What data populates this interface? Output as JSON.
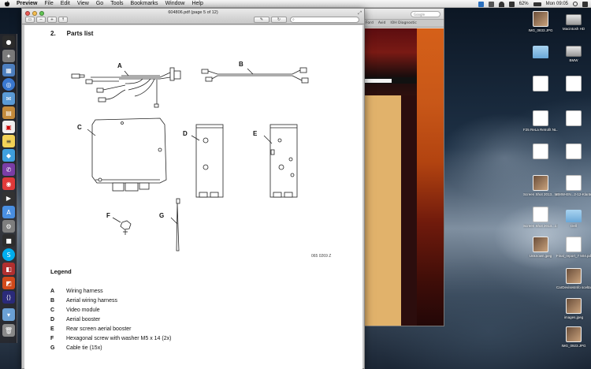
{
  "menubar": {
    "app_name": "Preview",
    "items": [
      "File",
      "Edit",
      "View",
      "Go",
      "Tools",
      "Bookmarks",
      "Window",
      "Help"
    ],
    "clock": "Mon 09:05",
    "battery": "62%",
    "battery_icon": "battery-icon",
    "wifi_icon": "wifi-icon"
  },
  "preview": {
    "title": "604806.pdf (page 5 of 12)",
    "search_placeholder": "",
    "page": {
      "heading_number": "2.",
      "heading_text": "Parts list",
      "part_labels": [
        "A",
        "B",
        "C",
        "D",
        "E",
        "F",
        "G"
      ],
      "drawing_number": "065 0269 Z",
      "legend_title": "Legend",
      "legend": [
        {
          "key": "A",
          "text": "Wiring harness"
        },
        {
          "key": "B",
          "text": "Aerial wiring harness"
        },
        {
          "key": "C",
          "text": "Video module"
        },
        {
          "key": "D",
          "text": "Aerial booster"
        },
        {
          "key": "E",
          "text": "Rear screen aerial booster"
        },
        {
          "key": "F",
          "text": "Hexagonal screw with washer M5 x 14 (2x)"
        },
        {
          "key": "G",
          "text": "Cable tie (15x)"
        }
      ]
    }
  },
  "browser": {
    "tabs": [
      "Ford",
      "Avid",
      "IOH Diagnostic"
    ],
    "search_placeholder": "Google"
  },
  "desktop_icons": [
    {
      "label": "IMG_0833.JPG",
      "kind": "img"
    },
    {
      "label": "Macintosh HD",
      "kind": "drive"
    },
    {
      "label": "",
      "kind": "folder"
    },
    {
      "label": "BMW",
      "kind": "drive"
    },
    {
      "label": "",
      "kind": "doc"
    },
    {
      "label": "",
      "kind": "doc"
    },
    {
      "label": "F25 ReLa Retrofit NL...PNG",
      "kind": "doc"
    },
    {
      "label": "",
      "kind": "doc"
    },
    {
      "label": "",
      "kind": "doc"
    },
    {
      "label": "",
      "kind": "doc"
    },
    {
      "label": "Screen Shot 2013...M.png",
      "kind": "img"
    },
    {
      "label": "BMW-EN...2-12-Klanter",
      "kind": "doc"
    },
    {
      "label": "Screen Shot 2013...1 PM",
      "kind": "doc"
    },
    {
      "label": "Dell",
      "kind": "folder"
    },
    {
      "label": "Unknown.jpeg",
      "kind": "img"
    },
    {
      "label": "Final_report_7 504.pdf",
      "kind": "pdf"
    },
    {
      "label": "CarDevisesInfo scelta...Exec",
      "kind": "img"
    },
    {
      "label": "images.jpeg",
      "kind": "img"
    },
    {
      "label": "IMG_0923.JPG",
      "kind": "img"
    }
  ],
  "colors": {
    "accent": "#3b7fd6",
    "traffic_red": "#ec5b55",
    "traffic_yellow": "#f6be4f",
    "traffic_green": "#62c554"
  }
}
